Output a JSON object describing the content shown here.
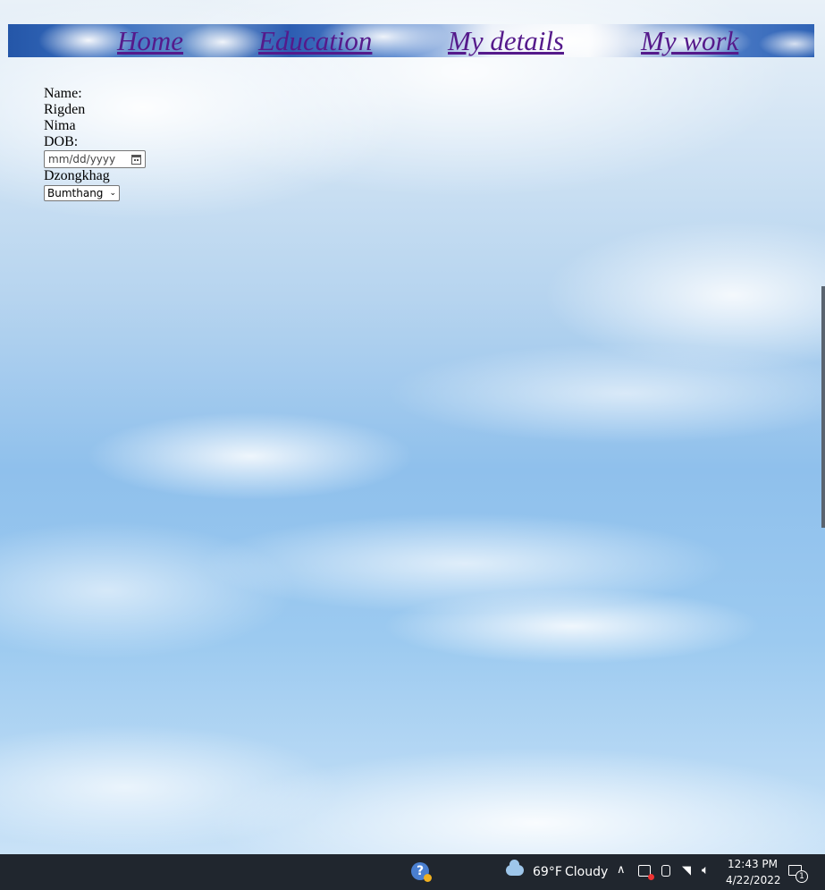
{
  "nav": {
    "links": [
      "Home",
      "Education",
      "My details",
      "My work"
    ]
  },
  "form": {
    "name_label": "Name:",
    "first_name": "Rigden",
    "last_name": "Nima",
    "dob_label": "DOB:",
    "dob_placeholder": "mm/dd/yyyy",
    "dzongkhag_label": "Dzongkhag",
    "dzongkhag_selected": "Bumthang"
  },
  "taskbar": {
    "temperature": "69°F",
    "condition": "Cloudy",
    "time": "12:43 PM",
    "date": "4/22/2022",
    "notification_count": "1"
  }
}
